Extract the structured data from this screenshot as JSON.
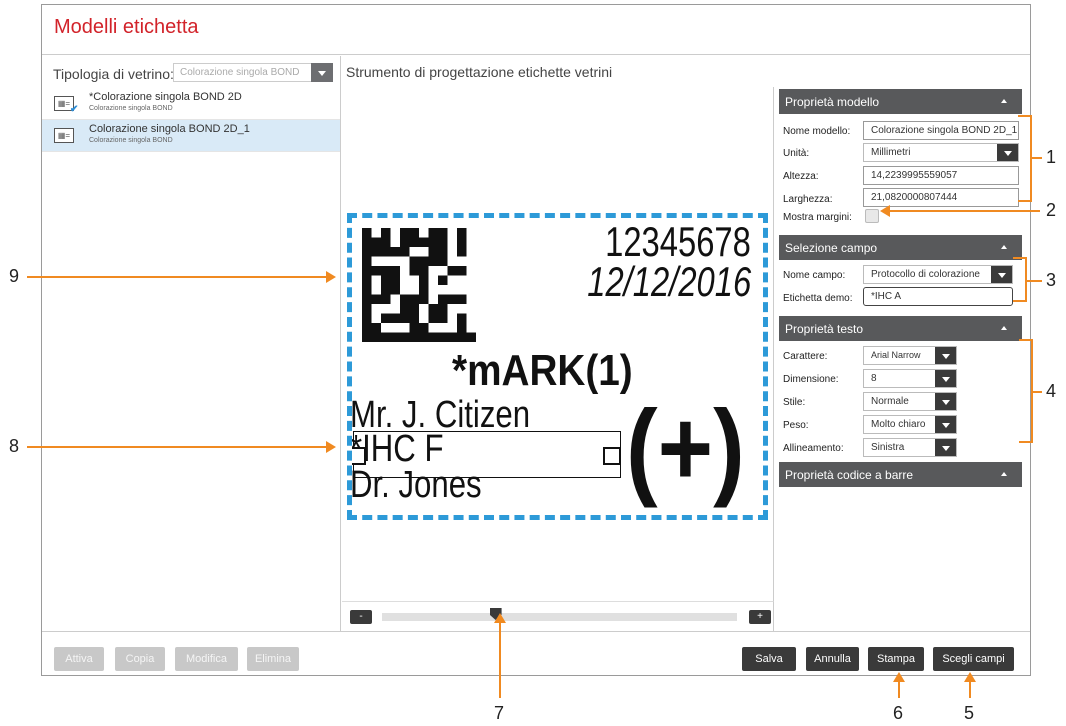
{
  "window": {
    "title": "Modelli etichetta"
  },
  "left": {
    "type_label": "Tipologia di vetrino:",
    "type_value": "Colorazione singola BOND",
    "templates": [
      {
        "name": "*Colorazione singola BOND 2D",
        "sub": "Colorazione singola BOND",
        "selected": false,
        "checked": true
      },
      {
        "name": "Colorazione singola BOND 2D_1",
        "sub": "Colorazione singola BOND",
        "selected": true,
        "checked": false
      }
    ]
  },
  "designer": {
    "header": "Strumento di progettazione etichette vetrini",
    "label": {
      "number": "12345678",
      "date": "12/12/2016",
      "mark": "*mARK(1)",
      "patient": "Mr. J. Citizen",
      "field_text": "*IHC F",
      "doctor": "Dr. Jones",
      "result": "(+)"
    },
    "zoom_minus": "-",
    "zoom_plus": "+",
    "zoom_level": 0.32
  },
  "props": {
    "model": {
      "title": "Proprietà modello",
      "name_label": "Nome modello:",
      "name_value": "Colorazione singola BOND 2D_1",
      "unit_label": "Unità:",
      "unit_value": "Millimetri",
      "height_label": "Altezza:",
      "height_value": "14,2239995559057",
      "width_label": "Larghezza:",
      "width_value": "21,0820000807444",
      "margins_label": "Mostra margini:"
    },
    "field": {
      "title": "Selezione campo",
      "name_label": "Nome campo:",
      "name_value": "Protocollo di colorazione",
      "demo_label": "Etichetta demo:",
      "demo_value": "*IHC A"
    },
    "text": {
      "title": "Proprietà testo",
      "font_label": "Carattere:",
      "font_value": "Arial Narrow",
      "size_label": "Dimensione:",
      "size_value": "8",
      "style_label": "Stile:",
      "style_value": "Normale",
      "weight_label": "Peso:",
      "weight_value": "Molto chiaro",
      "align_label": "Allineamento:",
      "align_value": "Sinistra"
    },
    "barcode": {
      "title": "Proprietà codice a barre"
    }
  },
  "buttons": {
    "activate": "Attiva",
    "copy": "Copia",
    "edit": "Modifica",
    "delete": "Elimina",
    "save": "Salva",
    "cancel": "Annulla",
    "print": "Stampa",
    "choose_fields": "Scegli campi"
  },
  "callouts": [
    "1",
    "2",
    "3",
    "4",
    "5",
    "6",
    "7",
    "8",
    "9"
  ],
  "colors": {
    "title": "#d2232a",
    "accent_orange": "#f08a21",
    "dashed_border": "#2d9ad8",
    "header_gray": "#58595b"
  }
}
